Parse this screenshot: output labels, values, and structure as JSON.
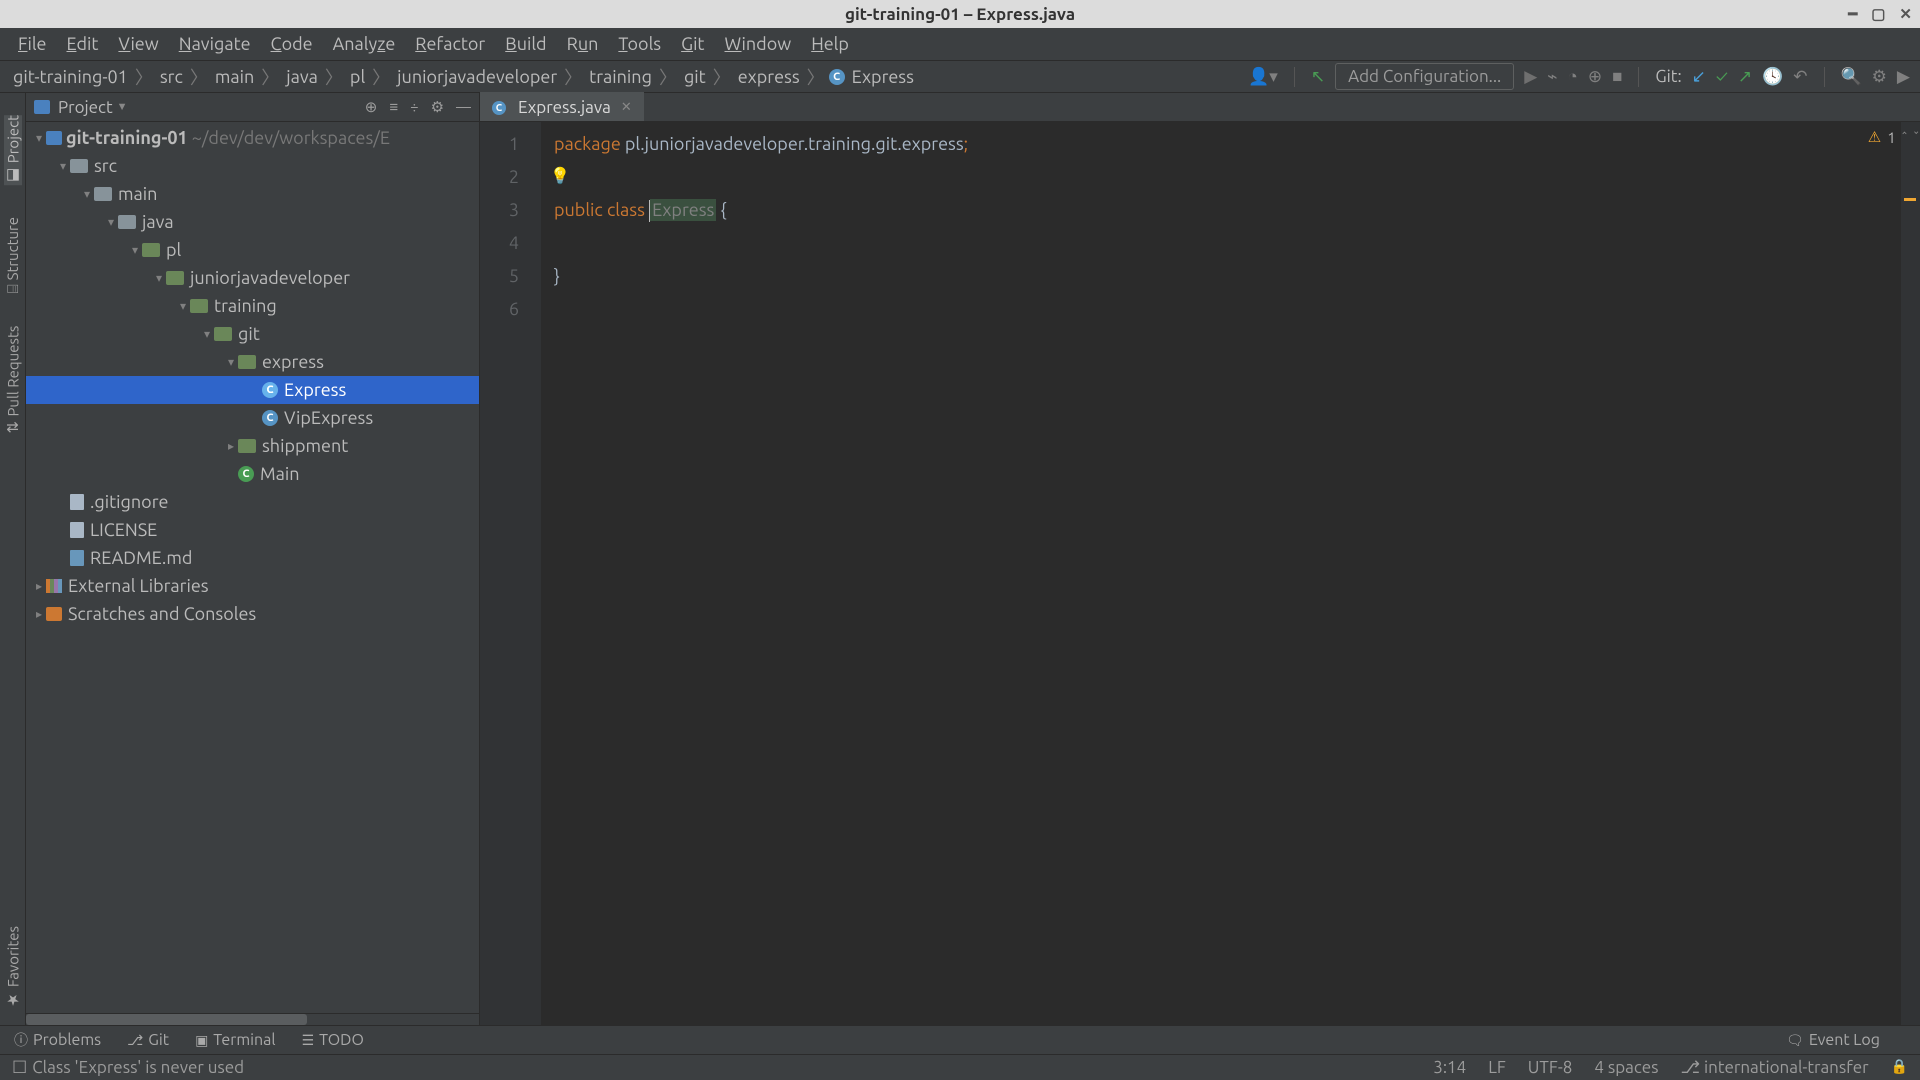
{
  "window": {
    "title": "git-training-01 – Express.java"
  },
  "menu": [
    "File",
    "Edit",
    "View",
    "Navigate",
    "Code",
    "Analyze",
    "Refactor",
    "Build",
    "Run",
    "Tools",
    "Git",
    "Window",
    "Help"
  ],
  "breadcrumbs": [
    "git-training-01",
    "src",
    "main",
    "java",
    "pl",
    "juniorjavadeveloper",
    "training",
    "git",
    "express",
    "Express"
  ],
  "toolbar": {
    "run_config": "Add Configuration...",
    "git_label": "Git:"
  },
  "project_panel": {
    "title": "Project",
    "root": {
      "name": "git-training-01",
      "path": "~/dev/dev/workspaces/E"
    },
    "tree": [
      "src",
      "main",
      "java",
      "pl",
      "juniorjavadeveloper",
      "training",
      "git",
      "express",
      "Express",
      "VipExpress",
      "shippment",
      "Main",
      ".gitignore",
      "LICENSE",
      "README.md",
      "External Libraries",
      "Scratches and Consoles"
    ]
  },
  "sidebar_tabs": {
    "project": "Project",
    "structure": "Structure",
    "pull": "Pull Requests",
    "favorites": "Favorites"
  },
  "editor": {
    "tab_label": "Express.java",
    "lines": {
      "l1_pkg_kw": "package",
      "l1_pkg_path": "pl.juniorjavadeveloper.training.git.express",
      "l3_public": "public",
      "l3_class": "class",
      "l3_name": "Express",
      "l3_brace": "{",
      "l5_brace": "}"
    },
    "line_numbers": [
      "1",
      "2",
      "3",
      "4",
      "5",
      "6"
    ],
    "warning_count": "1"
  },
  "bottom_tools": {
    "problems": "Problems",
    "git": "Git",
    "terminal": "Terminal",
    "todo": "TODO",
    "event_log": "Event Log"
  },
  "status": {
    "message": "Class 'Express' is never used",
    "pos": "3:14",
    "lineend": "LF",
    "encoding": "UTF-8",
    "indent": "4 spaces",
    "branch": "international-transfer"
  }
}
